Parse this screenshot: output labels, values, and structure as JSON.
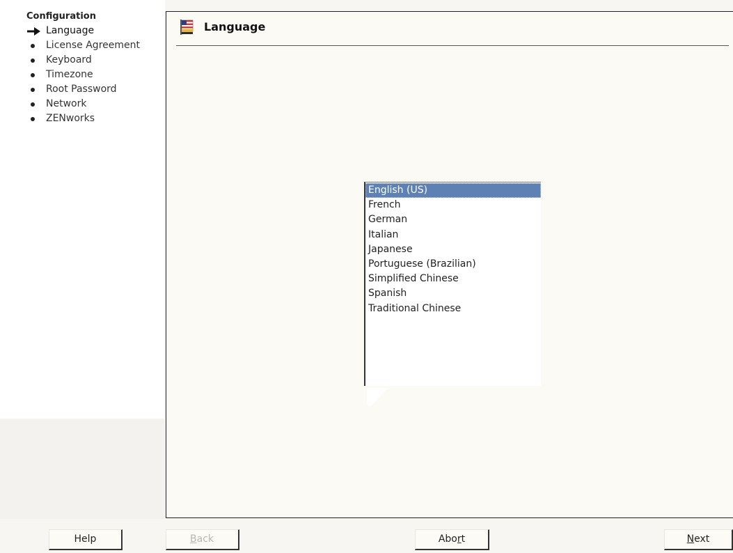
{
  "sidebar": {
    "title": "Configuration",
    "steps": [
      {
        "label": "Language",
        "state": "current"
      },
      {
        "label": "License Agreement",
        "state": "pending"
      },
      {
        "label": "Keyboard",
        "state": "pending"
      },
      {
        "label": "Timezone",
        "state": "pending"
      },
      {
        "label": "Root Password",
        "state": "pending"
      },
      {
        "label": "Network",
        "state": "pending"
      },
      {
        "label": "ZENworks",
        "state": "pending"
      }
    ]
  },
  "header": {
    "title": "Language",
    "icon": "flag-icon"
  },
  "languages": {
    "selected": "English (US)",
    "items": [
      "English (US)",
      "French",
      "German",
      "Italian",
      "Japanese",
      "Portuguese (Brazilian)",
      "Simplified Chinese",
      "Spanish",
      "Traditional Chinese"
    ]
  },
  "buttons": {
    "help": {
      "label": "Help",
      "enabled": true
    },
    "back": {
      "pre": "",
      "mnemonic": "B",
      "post": "ack",
      "enabled": false
    },
    "abort": {
      "pre": "Abo",
      "mnemonic": "r",
      "post": "t",
      "enabled": true
    },
    "next": {
      "pre": "",
      "mnemonic": "N",
      "post": "ext",
      "enabled": true
    }
  },
  "colors": {
    "selection": "#5e81b5",
    "panel_background": "#fcfaf4",
    "flag_red": "#d22b2b",
    "flag_blue": "#2c3d8f",
    "flag_gold": "#e8b830"
  }
}
